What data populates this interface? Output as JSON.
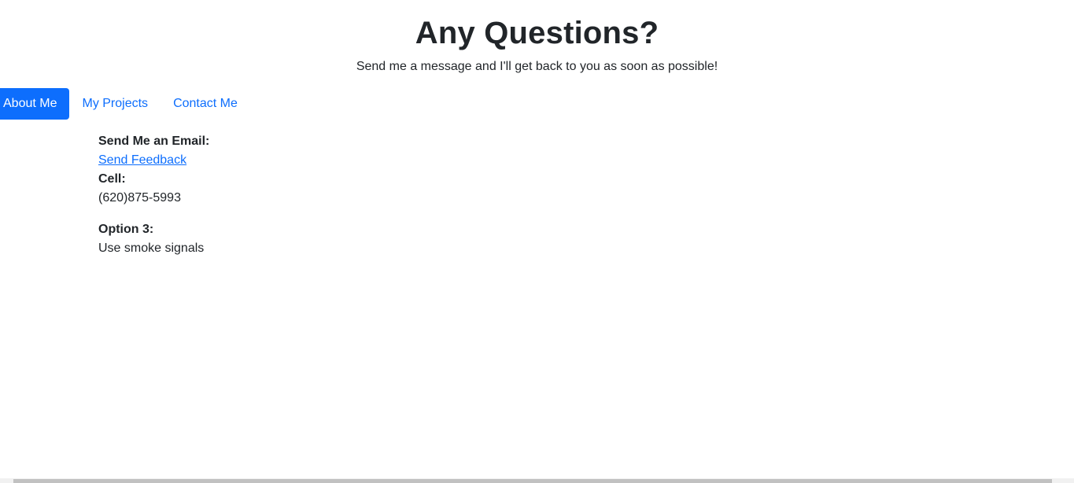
{
  "header": {
    "title": "Any Questions?",
    "subtitle": "Send me a message and I'll get back to you as soon as possible!"
  },
  "nav": {
    "items": [
      {
        "label": "About Me",
        "active": true
      },
      {
        "label": "My Projects",
        "active": false
      },
      {
        "label": "Contact Me",
        "active": false
      }
    ]
  },
  "contact": {
    "email_label": "Send Me an Email:",
    "email_link": "Send Feedback",
    "cell_label": "Cell:",
    "cell_value": "(620)875-5993",
    "option3_label": "Option 3:",
    "option3_value": "Use smoke signals"
  },
  "colors": {
    "accent": "#0d6efd",
    "text": "#212529",
    "background": "#ffffff"
  }
}
